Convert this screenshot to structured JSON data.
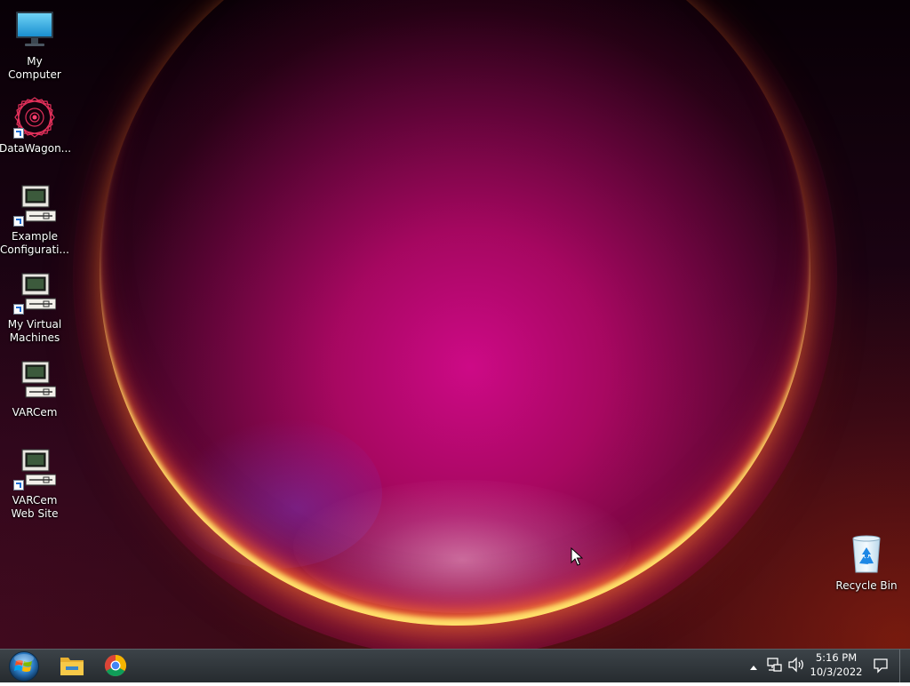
{
  "desktop": {
    "icons": [
      {
        "label": "My Computer",
        "icon": "monitor-icon"
      },
      {
        "label": "DataWagon...",
        "icon": "datawagon-logo-icon",
        "shortcut": true
      },
      {
        "label": "Example Configurati...",
        "icon": "vm-computer-icon",
        "shortcut": true
      },
      {
        "label": "My Virtual Machines",
        "icon": "vm-computer-icon",
        "shortcut": true
      },
      {
        "label": "VARCem",
        "icon": "vm-computer-icon",
        "shortcut": false
      },
      {
        "label": "VARCem Web Site",
        "icon": "vm-computer-icon",
        "shortcut": true
      }
    ],
    "recycle_bin": {
      "label": "Recycle Bin",
      "icon": "recycle-bin-icon"
    }
  },
  "taskbar": {
    "start": {
      "icon": "windows-start-orb-icon"
    },
    "pinned": [
      {
        "name": "File Explorer",
        "icon": "folder-icon"
      },
      {
        "name": "Google Chrome",
        "icon": "chrome-icon"
      }
    ],
    "tray": {
      "icons": [
        "show-hidden-icons-arrow-icon",
        "network-icon",
        "volume-icon",
        "action-center-icon"
      ]
    },
    "clock": {
      "time": "5:16 PM",
      "date": "10/3/2022"
    }
  },
  "colors": {
    "taskbar": "#2e3438",
    "wallpaper_magenta": "#c20a8a",
    "wallpaper_ring_yellow": "#ffd86a",
    "wallpaper_ring_orange": "#ff7a28"
  }
}
